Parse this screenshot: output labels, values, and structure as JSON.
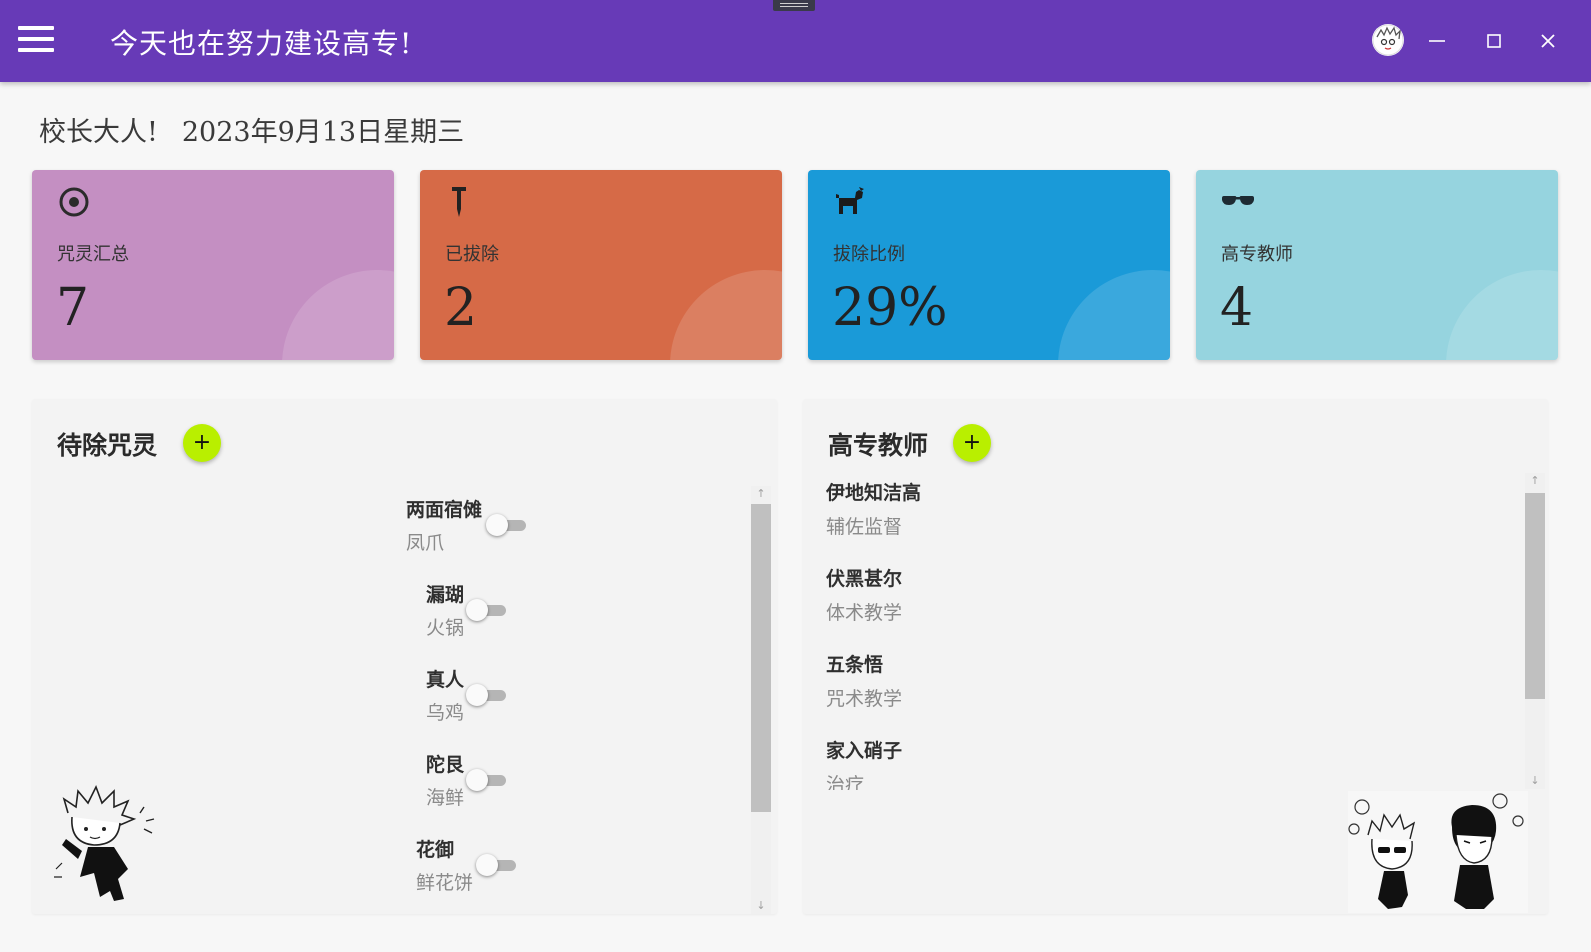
{
  "app": {
    "title": "今天也在努力建设高专!",
    "avatar": "avatar-chibi-icon"
  },
  "window_controls": {
    "minimize": "minimize-icon",
    "maximize": "maximize-icon",
    "close": "close-icon"
  },
  "greeting": {
    "salutation": "校长大人!",
    "date": "2023年9月13日星期三"
  },
  "stats": [
    {
      "label": "咒灵汇总",
      "value": "7",
      "icon": "target-icon",
      "color": "#c48fc2"
    },
    {
      "label": "已拔除",
      "value": "2",
      "icon": "stake-icon",
      "color": "#d66a47"
    },
    {
      "label": "拔除比例",
      "value": "29%",
      "icon": "dog-icon",
      "color": "#1a9ad8"
    },
    {
      "label": "高专教师",
      "value": "4",
      "icon": "sunglasses-icon",
      "color": "#96d4df"
    }
  ],
  "curses_panel": {
    "title": "待除咒灵",
    "add_label": "+",
    "items": [
      {
        "name": "两面宿傩",
        "sub": "凤爪",
        "exorcised": false
      },
      {
        "name": "漏瑚",
        "sub": "火锅",
        "exorcised": false
      },
      {
        "name": "真人",
        "sub": "乌鸡",
        "exorcised": false
      },
      {
        "name": "陀艮",
        "sub": "海鲜",
        "exorcised": false
      },
      {
        "name": "花御",
        "sub": "鲜花饼",
        "exorcised": false
      }
    ]
  },
  "teachers_panel": {
    "title": "高专教师",
    "add_label": "+",
    "items": [
      {
        "name": "伊地知洁高",
        "role": "辅佐监督"
      },
      {
        "name": "伏黑甚尔",
        "role": "体术教学"
      },
      {
        "name": "五条悟",
        "role": "咒术教学"
      },
      {
        "name": "家入硝子",
        "role": "治疗"
      }
    ]
  },
  "colors": {
    "appbar": "#673ab7",
    "accent_button": "#b9ef00"
  }
}
